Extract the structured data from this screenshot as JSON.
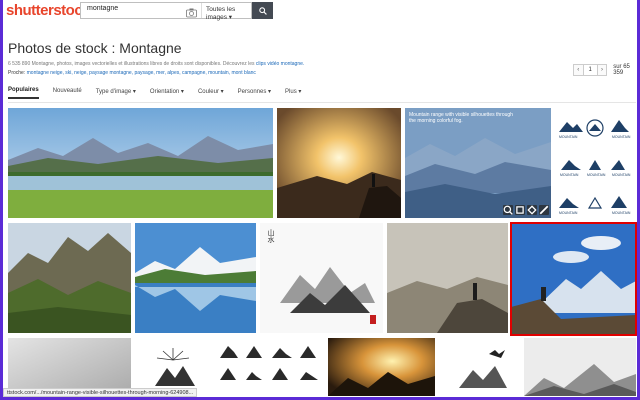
{
  "header": {
    "logo": "shutterstock",
    "search_value": "montagne",
    "filter_label": "Toutes les images ▾"
  },
  "page": {
    "title": "Photos de stock : Montagne",
    "info_text": "6 535 890 Montagne, photos, images vectorielles et illustrations libres de droits sont disponibles. Découvrez les",
    "info_link": "clips vidéo montagne.",
    "related_label": "Proche:",
    "related_links": "montagne neige, ski, neige, paysage montagne, paysage, mer, alpes, campagne, mountain, mont blanc"
  },
  "pager": {
    "prev": "‹",
    "current": "1",
    "next": "›",
    "total": "sur 65 359"
  },
  "filters": {
    "f0": "Populaires",
    "f1": "Nouveauté",
    "f2": "Type d'image ▾",
    "f3": "Orientation ▾",
    "f4": "Couleur ▾",
    "f5": "Personnes ▾",
    "f6": "Plus ▾"
  },
  "tiles": {
    "hover_caption": "Mountain range with visible silhouettes through the morning colorful fog.",
    "logo_labels": {
      "l1": "MOUNTAIN",
      "l2": "MOUNTAIN",
      "l3": "MOUNTAIN",
      "l4": "MOUNTAIN",
      "l5": "MOUNTAIN",
      "l6": "MOUNTAIN",
      "l7": "MOUNTAIN"
    },
    "calligraphy": "山水"
  },
  "status_bar": {
    "url": "ttstock.com/.../mountain-range-visible-silhouettes-through-morning-624908..."
  },
  "colors": {
    "logo": "#e8452c",
    "frame": "#5b2bd6",
    "link": "#1a68b8",
    "selection": "#e00000"
  }
}
